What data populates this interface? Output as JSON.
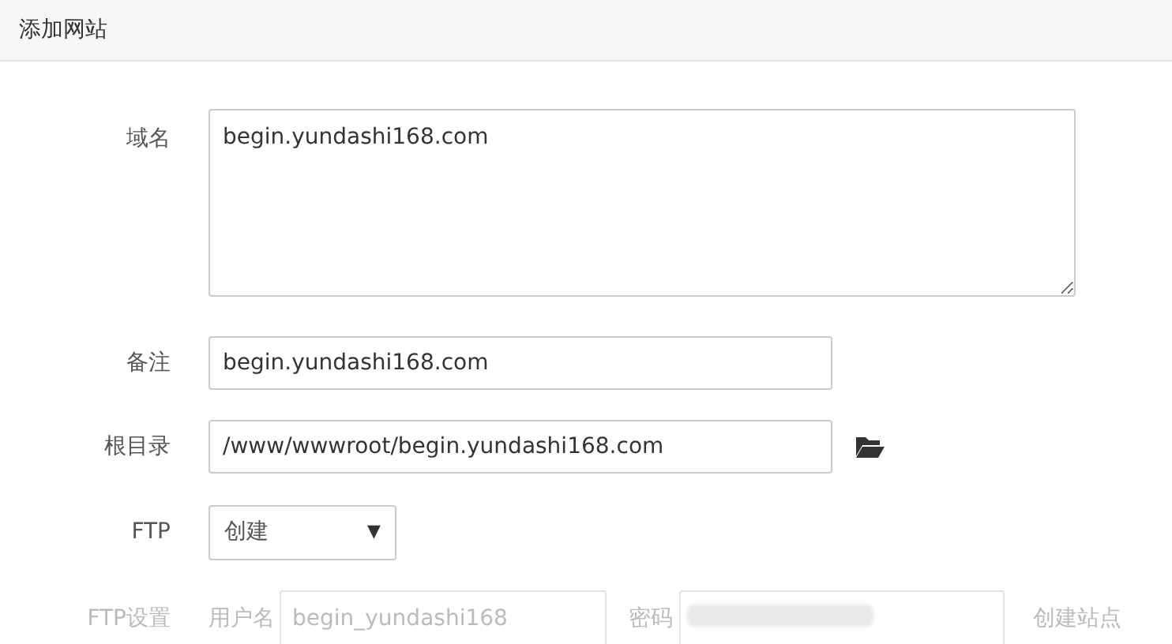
{
  "window": {
    "title": "添加网站"
  },
  "domain": {
    "label": "域名",
    "value": "begin.yundashi168.com"
  },
  "note": {
    "label": "备注",
    "value": "begin.yundashi168.com"
  },
  "root": {
    "label": "根目录",
    "value": "/www/wwwroot/begin.yundashi168.com"
  },
  "ftp": {
    "label": "FTP",
    "value": "创建",
    "caret": "▼"
  },
  "ftp_settings": {
    "label": "FTP设置",
    "disabled": true,
    "username_label": "用户名",
    "username": "begin_yundashi168",
    "password_label": "密码",
    "action": "创建站点"
  }
}
